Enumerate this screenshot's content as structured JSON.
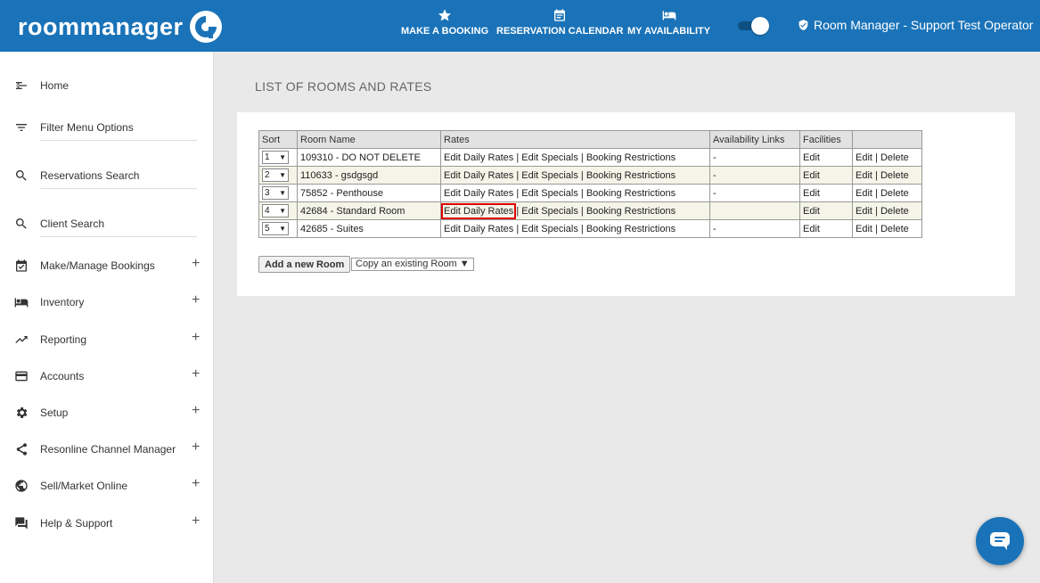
{
  "header": {
    "logo_text": "roommanager",
    "nav": [
      {
        "label": "MAKE A BOOKING",
        "icon": "star-icon"
      },
      {
        "label": "RESERVATION CALENDAR",
        "icon": "calendar-icon"
      },
      {
        "label": "MY AVAILABILITY",
        "icon": "bed-icon"
      }
    ],
    "toggle_on": true,
    "user_label": "Room Manager - Support Test Operator"
  },
  "sidebar": {
    "items": [
      {
        "label": "Home",
        "icon": "back-arrow-icon",
        "expandable": false
      },
      {
        "label": "Filter Menu Options",
        "icon": "filter-icon",
        "expandable": false
      },
      {
        "label": "Reservations Search",
        "icon": "search-icon",
        "expandable": false
      },
      {
        "label": "Client Search",
        "icon": "search-icon",
        "expandable": false
      },
      {
        "label": "Make/Manage Bookings",
        "icon": "calendar-check-icon",
        "expandable": true
      },
      {
        "label": "Inventory",
        "icon": "bed-icon",
        "expandable": true
      },
      {
        "label": "Reporting",
        "icon": "trending-up-icon",
        "expandable": true
      },
      {
        "label": "Accounts",
        "icon": "credit-card-icon",
        "expandable": true
      },
      {
        "label": "Setup",
        "icon": "gear-icon",
        "expandable": true
      },
      {
        "label": "Resonline Channel Manager",
        "icon": "share-icon",
        "expandable": true
      },
      {
        "label": "Sell/Market Online",
        "icon": "globe-icon",
        "expandable": true
      },
      {
        "label": "Help & Support",
        "icon": "chat-bubbles-icon",
        "expandable": true
      }
    ],
    "plus_symbol": "+"
  },
  "main": {
    "title": "LIST OF ROOMS AND RATES",
    "table": {
      "headers": [
        "Sort",
        "Room Name",
        "Rates",
        "Availability Links",
        "Facilities",
        ""
      ],
      "rows": [
        {
          "sort": "1",
          "name": "109310 - DO NOT DELETE",
          "avail": "-",
          "facilities": "Edit"
        },
        {
          "sort": "2",
          "name": "110633 - gsdgsgd",
          "avail": "-",
          "facilities": "Edit"
        },
        {
          "sort": "3",
          "name": "75852 - Penthouse",
          "avail": "-",
          "facilities": "Edit"
        },
        {
          "sort": "4",
          "name": "42684 - Standard Room",
          "avail": "",
          "facilities": "Edit"
        },
        {
          "sort": "5",
          "name": "42685 - Suites",
          "avail": "-",
          "facilities": "Edit"
        }
      ],
      "rate_links": {
        "daily": "Edit Daily Rates",
        "specials": "Edit Specials",
        "restrictions": "Booking Restrictions",
        "sep": "|"
      },
      "action_links": {
        "edit": "Edit",
        "delete": "Delete",
        "sep": "|"
      },
      "dropdown_arrow": "▼"
    },
    "add_button": "Add a new Room",
    "copy_select": "Copy an existing Room ▼"
  },
  "colors": {
    "header_bg": "#1a73b8",
    "highlight": "#e00000",
    "page_bg": "#e9e9e9"
  }
}
